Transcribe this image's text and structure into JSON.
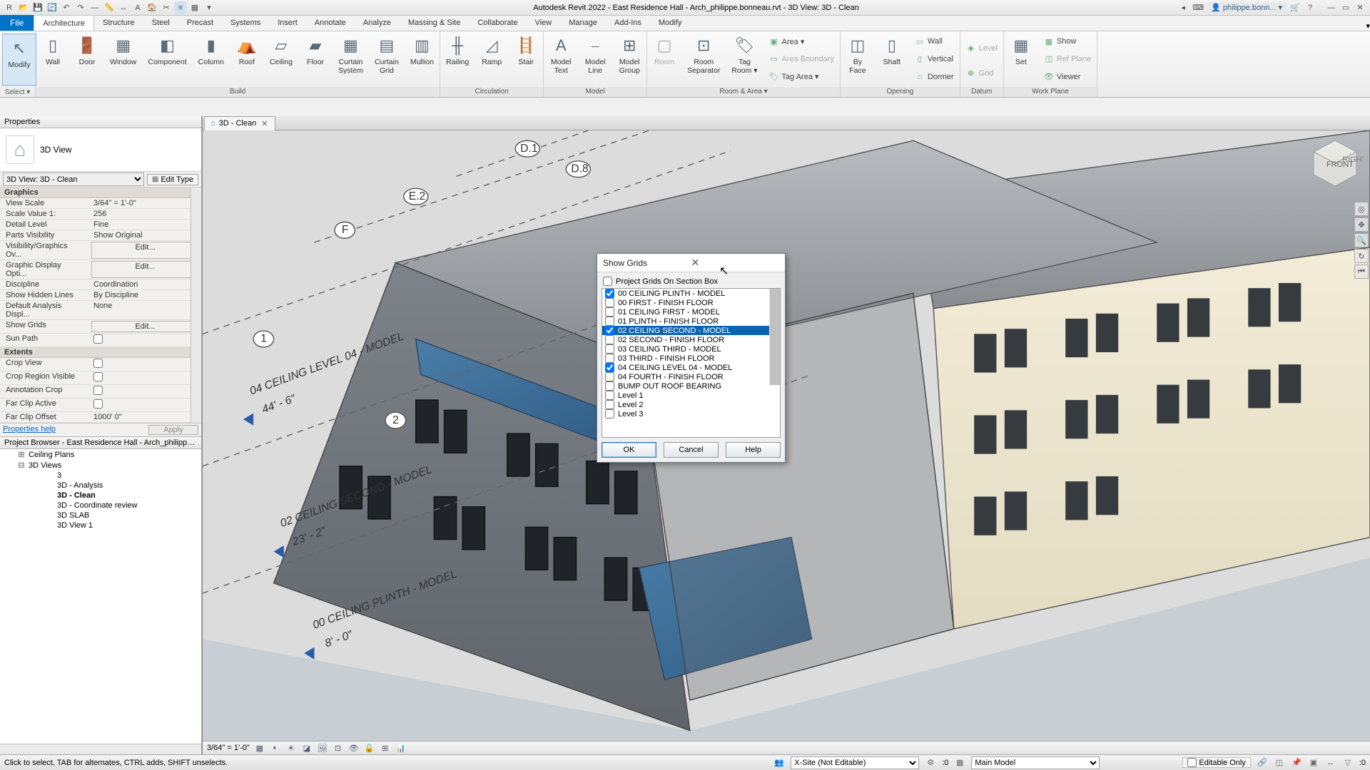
{
  "titlebar": {
    "title": "Autodesk Revit 2022 - East Residence Hall - Arch_philippe.bonneau.rvt - 3D View: 3D - Clean",
    "user": "philippe.bonn..."
  },
  "ribbon_tabs": [
    "Architecture",
    "Structure",
    "Steel",
    "Precast",
    "Systems",
    "Insert",
    "Annotate",
    "Analyze",
    "Massing & Site",
    "Collaborate",
    "View",
    "Manage",
    "Add-Ins",
    "Modify"
  ],
  "ribbon": {
    "select_panel": "Select ▾",
    "modify": "Modify",
    "build": {
      "panel": "Build",
      "wall": "Wall",
      "door": "Door",
      "window": "Window",
      "component": "Component",
      "column": "Column",
      "roof": "Roof",
      "ceiling": "Ceiling",
      "floor": "Floor",
      "curtain_system": "Curtain\nSystem",
      "curtain_grid": "Curtain\nGrid",
      "mullion": "Mullion"
    },
    "circulation": {
      "panel": "Circulation",
      "railing": "Railing",
      "ramp": "Ramp",
      "stair": "Stair"
    },
    "model": {
      "panel": "Model",
      "text": "Model\nText",
      "line": "Model\nLine",
      "group": "Model\nGroup"
    },
    "room_area": {
      "panel": "Room & Area ▾",
      "room": "Room",
      "separator": "Room\nSeparator",
      "tag": "Tag\nRoom ▾",
      "area": "Area ▾",
      "boundary": "Area Boundary",
      "tag_area": "Tag Area ▾"
    },
    "opening": {
      "panel": "Opening",
      "byface": "By\nFace",
      "shaft": "Shaft",
      "wall": "Wall",
      "vertical": "Vertical",
      "dormer": "Dormer"
    },
    "datum": {
      "panel": "Datum",
      "level": "Level",
      "grid": "Grid"
    },
    "workplane": {
      "panel": "Work Plane",
      "set": "Set",
      "show": "Show",
      "refplane": "Ref Plane",
      "viewer": "Viewer"
    }
  },
  "properties": {
    "title": "Properties",
    "type_name": "3D View",
    "view_selector": "3D View: 3D - Clean",
    "edit_type": "Edit Type",
    "cats": {
      "graphics": "Graphics",
      "extents": "Extents"
    },
    "rows": {
      "view_scale": {
        "k": "View Scale",
        "v": "3/64\" = 1'-0\""
      },
      "scale_value": {
        "k": "Scale Value   1:",
        "v": "256"
      },
      "detail_level": {
        "k": "Detail Level",
        "v": "Fine"
      },
      "parts_vis": {
        "k": "Parts Visibility",
        "v": "Show Original"
      },
      "vg": {
        "k": "Visibility/Graphics Ov...",
        "v": "Edit..."
      },
      "gdo": {
        "k": "Graphic Display Opti...",
        "v": "Edit..."
      },
      "discipline": {
        "k": "Discipline",
        "v": "Coordination"
      },
      "hidden": {
        "k": "Show Hidden Lines",
        "v": "By Discipline"
      },
      "analysis": {
        "k": "Default Analysis Displ...",
        "v": "None"
      },
      "show_grids": {
        "k": "Show Grids",
        "v": "Edit..."
      },
      "sun_path": {
        "k": "Sun Path"
      },
      "crop_view": {
        "k": "Crop View"
      },
      "crop_vis": {
        "k": "Crop Region Visible"
      },
      "anno_crop": {
        "k": "Annotation Crop"
      },
      "far_clip": {
        "k": "Far Clip Active"
      },
      "far_clip_off": {
        "k": "Far Clip Offset",
        "v": "1000'  0\""
      }
    },
    "help": "Properties help",
    "apply": "Apply"
  },
  "project_browser": {
    "title": "Project Browser - East Residence Hall - Arch_philippe...",
    "items": [
      {
        "lvl": 1,
        "tw": "⊞",
        "label": "Ceiling Plans"
      },
      {
        "lvl": 1,
        "tw": "⊟",
        "label": "3D Views"
      },
      {
        "lvl": 3,
        "tw": "",
        "label": "3"
      },
      {
        "lvl": 3,
        "tw": "",
        "label": "3D - Analysis"
      },
      {
        "lvl": 3,
        "tw": "",
        "label": "3D - Clean",
        "sel": true
      },
      {
        "lvl": 3,
        "tw": "",
        "label": "3D - Coordinate review"
      },
      {
        "lvl": 3,
        "tw": "",
        "label": "3D SLAB"
      },
      {
        "lvl": 3,
        "tw": "",
        "label": "3D View 1"
      }
    ]
  },
  "view_tab": {
    "label": "3D - Clean"
  },
  "view_scale_bar": "3/64\" = 1'-0\"",
  "statusbar": {
    "hint": "Click to select, TAB for alternates, CTRL adds, SHIFT unselects.",
    "workset": "X-Site (Not Editable)",
    "zero": ":0",
    "phase": "Main Model",
    "editable_only": "Editable Only"
  },
  "dialog": {
    "title": "Show Grids",
    "project_chk": "Project Grids On Section Box",
    "items": [
      {
        "label": "00 CEILING PLINTH - MODEL",
        "chk": true
      },
      {
        "label": "00 FIRST - FINISH FLOOR",
        "chk": false
      },
      {
        "label": "01 CEILING FIRST - MODEL",
        "chk": false
      },
      {
        "label": "01 PLINTH - FINISH FLOOR",
        "chk": false
      },
      {
        "label": "02 CEILING SECOND - MODEL",
        "chk": true,
        "sel": true
      },
      {
        "label": "02 SECOND - FINISH FLOOR",
        "chk": false
      },
      {
        "label": "03 CEILING THIRD - MODEL",
        "chk": false
      },
      {
        "label": "03 THIRD - FINISH FLOOR",
        "chk": false
      },
      {
        "label": "04 CEILING LEVEL 04 - MODEL",
        "chk": true
      },
      {
        "label": "04 FOURTH - FINISH FLOOR",
        "chk": false
      },
      {
        "label": "BUMP OUT ROOF BEARING",
        "chk": false
      },
      {
        "label": "Level 1",
        "chk": false
      },
      {
        "label": "Level 2",
        "chk": false
      },
      {
        "label": "Level 3",
        "chk": false
      }
    ],
    "ok": "OK",
    "cancel": "Cancel",
    "help": "Help"
  },
  "canvas_annotations": {
    "lvl04": {
      "a": "04 CEILING LEVEL 04 - MODEL",
      "b": "44' - 6\""
    },
    "lvl02": {
      "a": "02 CEILING SECOND - MODEL",
      "b": "23' - 2\""
    },
    "lvl00": {
      "a": "00 CEILING PLINTH - MODEL",
      "b": "8' - 0\""
    },
    "gridD1": "D.1",
    "gridD8": "D.8",
    "gridE2": "E.2",
    "gridF": "F",
    "grid1": "1",
    "grid2": "2"
  }
}
